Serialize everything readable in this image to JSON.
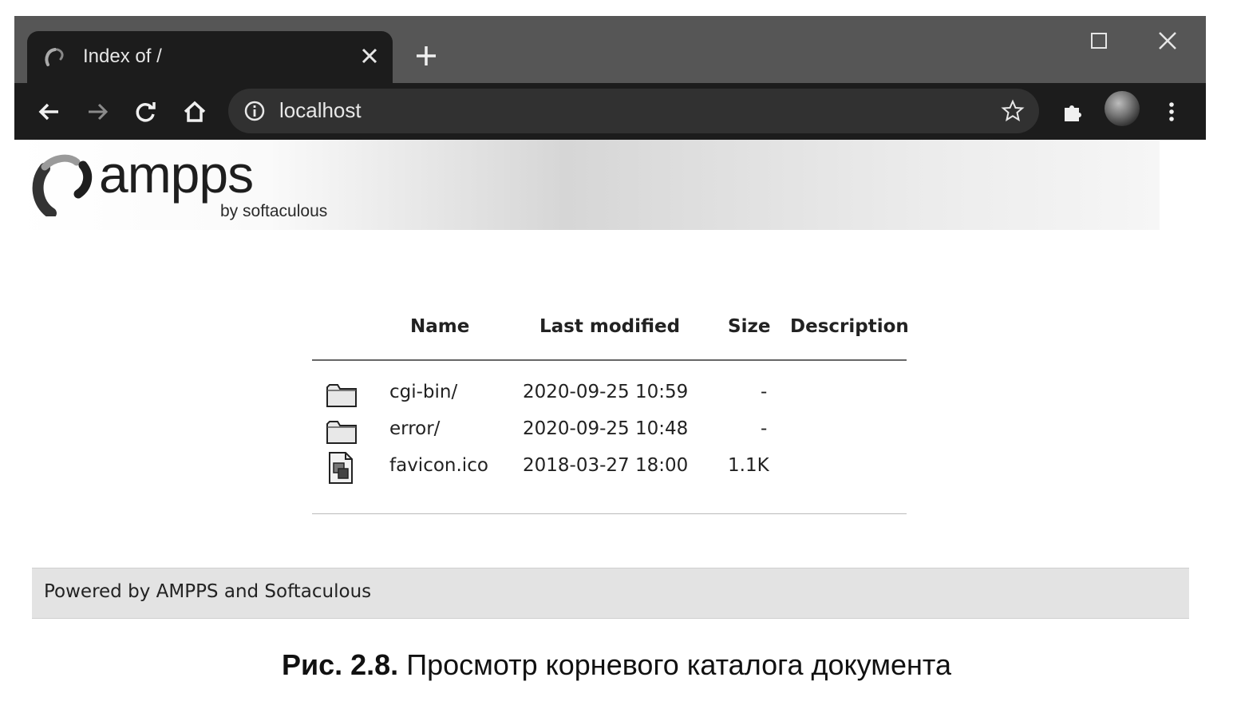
{
  "browser": {
    "tab": {
      "title": "Index of /",
      "favicon": "ampps-swirl-icon",
      "close_icon": "close-icon"
    },
    "new_tab_icon": "plus-icon",
    "window_controls": [
      "maximize-icon",
      "close-icon"
    ],
    "toolbar": {
      "back_icon": "back-arrow-icon",
      "forward_icon": "forward-arrow-icon",
      "reload_icon": "reload-icon",
      "home_icon": "home-icon",
      "address": {
        "info_icon": "info-icon",
        "url": "localhost",
        "bookmark_icon": "star-icon"
      },
      "extensions_icon": "puzzle-icon",
      "profile": "avatar",
      "menu_icon": "kebab-menu-icon"
    }
  },
  "page": {
    "logo": {
      "text": "ampps",
      "sub": "by softaculous"
    },
    "listing": {
      "headers": {
        "name": "Name",
        "last_modified": "Last modified",
        "size": "Size",
        "description": "Description"
      },
      "rows": [
        {
          "icon": "folder-icon",
          "name": "cgi-bin/",
          "modified": "2020-09-25 10:59",
          "size": "-",
          "description": ""
        },
        {
          "icon": "folder-icon",
          "name": "error/",
          "modified": "2020-09-25 10:48",
          "size": "-",
          "description": ""
        },
        {
          "icon": "image-file-icon",
          "name": "favicon.ico",
          "modified": "2018-03-27 18:00",
          "size": "1.1K",
          "description": ""
        }
      ]
    },
    "footer": "Powered by AMPPS and Softaculous"
  },
  "caption": {
    "number": "Рис. 2.8.",
    "text": "Просмотр корневого каталога документа"
  },
  "colors": {
    "tab_strip": "#565656",
    "toolbar": "#1c1c1c",
    "omnibox": "#313131",
    "footer_bg": "#e3e3e3"
  }
}
